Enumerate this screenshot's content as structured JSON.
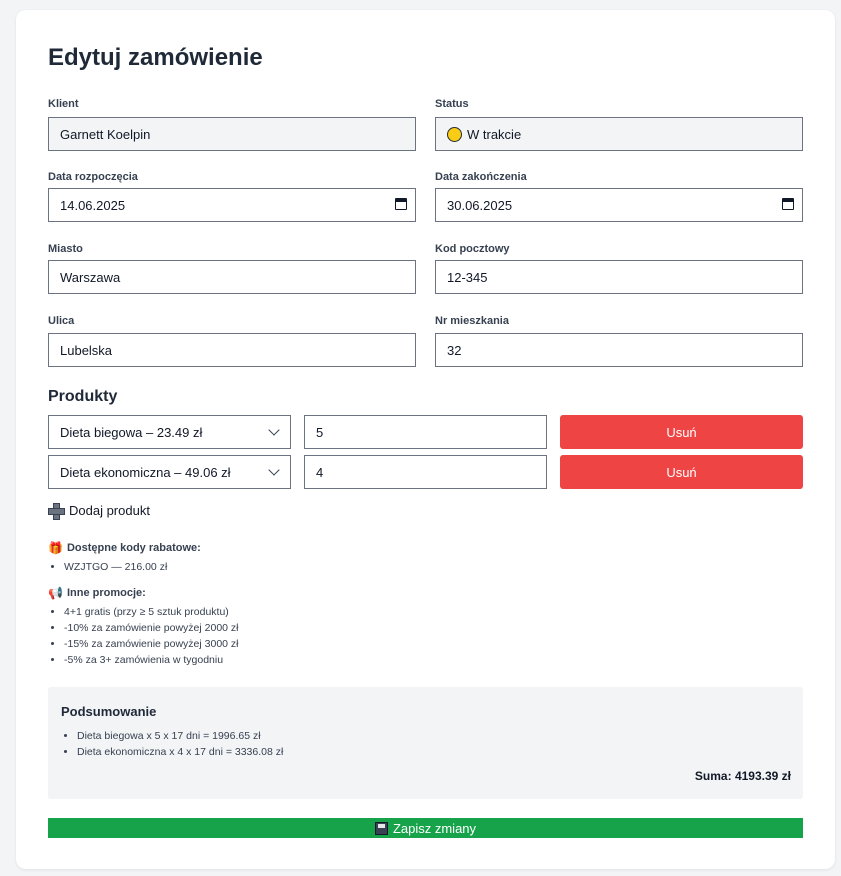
{
  "form": {
    "title": "Edytuj zamówienie",
    "client": {
      "label": "Klient",
      "value": "Garnett Koelpin"
    },
    "status": {
      "label": "Status",
      "value": "W trakcie",
      "color": "#facc15"
    },
    "start_date": {
      "label": "Data rozpoczęcia",
      "value": "14.06.2025"
    },
    "end_date": {
      "label": "Data zakończenia",
      "value": "30.06.2025"
    },
    "city": {
      "label": "Miasto",
      "value": "Warszawa"
    },
    "postal": {
      "label": "Kod pocztowy",
      "value": "12-345"
    },
    "street": {
      "label": "Ulica",
      "value": "Lubelska"
    },
    "apartment": {
      "label": "Nr mieszkania",
      "value": "32"
    }
  },
  "products": {
    "heading": "Produkty",
    "rows": [
      {
        "product": "Dieta biegowa – 23.49 zł",
        "quantity": "5",
        "remove_label": "Usuń"
      },
      {
        "product": "Dieta ekonomiczna – 49.06 zł",
        "quantity": "4",
        "remove_label": "Usuń"
      }
    ],
    "add_label": "Dodaj produkt"
  },
  "discounts": {
    "heading": "Dostępne kody rabatowe:",
    "icon": "gift-icon",
    "items": [
      "WZJTGO — 216.00 zł"
    ]
  },
  "promotions": {
    "heading": "Inne promocje:",
    "icon": "megaphone-icon",
    "items": [
      "4+1 gratis (przy ≥ 5 sztuk produktu)",
      "-10% za zamówienie powyżej 2000 zł",
      "-15% za zamówienie powyżej 3000 zł",
      "-5% za 3+ zamówienia w tygodniu"
    ]
  },
  "summary": {
    "heading": "Podsumowanie",
    "lines": [
      "Dieta biegowa x 5 x 17 dni = 1996.65 zł",
      "Dieta ekonomiczna x 4 x 17 dni = 3336.08 zł"
    ],
    "total_label": "Suma:",
    "total_value": "4193.39 zł"
  },
  "save_label": "Zapisz zmiany",
  "colors": {
    "danger": "#ef4444",
    "success": "#16a34a",
    "panel": "#f3f4f6"
  }
}
